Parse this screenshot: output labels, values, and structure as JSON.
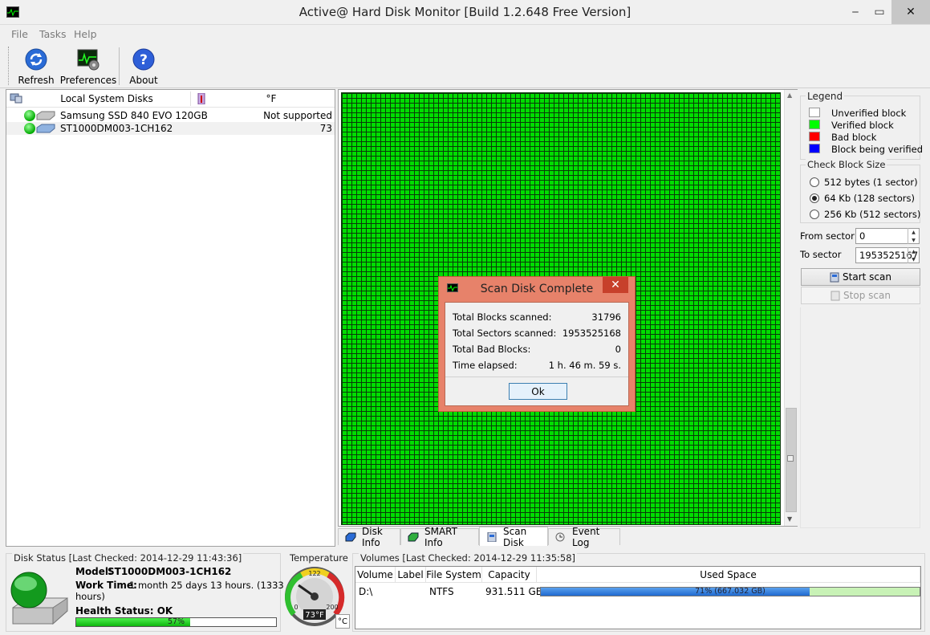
{
  "window": {
    "title": "Active@ Hard Disk Monitor [Build 1.2.648 Free Version]",
    "minimize": "‒",
    "maximize": "▭",
    "close": "✕"
  },
  "menu": {
    "file": "File",
    "tasks": "Tasks",
    "help": "Help"
  },
  "toolbar": {
    "refresh": "Refresh",
    "preferences": "Preferences",
    "about": "About"
  },
  "disks": {
    "header_name": "Local System Disks",
    "header_temp_unit": "°F",
    "items": [
      {
        "name": "Samsung SSD 840 EVO 120GB",
        "temp": "Not supported"
      },
      {
        "name": "ST1000DM003-1CH162",
        "temp": "73"
      }
    ]
  },
  "legend": {
    "title": "Legend",
    "items": [
      {
        "label": "Unverified block",
        "color": "#ffffff"
      },
      {
        "label": "Verified block",
        "color": "#00ff00"
      },
      {
        "label": "Bad block",
        "color": "#ff0000"
      },
      {
        "label": "Block being verified",
        "color": "#0000ff"
      }
    ]
  },
  "block_size": {
    "title": "Check Block Size",
    "options": [
      "512 bytes (1 sector)",
      "64 Kb (128 sectors)",
      "256 Kb (512 sectors)"
    ],
    "selected": "64 Kb (128 sectors)"
  },
  "range": {
    "from_label": "From sector",
    "from_value": "0",
    "to_label": "To sector",
    "to_value": "1953525167"
  },
  "scan_buttons": {
    "start": "Start scan",
    "stop": "Stop scan"
  },
  "tabs": {
    "disk_info": "Disk Info",
    "smart_info": "SMART Info",
    "scan_disk": "Scan Disk",
    "event_log": "Event Log",
    "active": "Scan Disk"
  },
  "dialog": {
    "title": "Scan Disk Complete",
    "rows": [
      {
        "label": "Total Blocks scanned:",
        "value": "31796"
      },
      {
        "label": "Total Sectors scanned:",
        "value": "1953525168"
      },
      {
        "label": "Total Bad Blocks:",
        "value": "0"
      },
      {
        "label": "Time elapsed:",
        "value": "1 h. 46 m. 59 s."
      }
    ],
    "ok": "Ok"
  },
  "disk_status": {
    "group_label": "Disk Status [Last Checked: 2014-12-29 11:43:36]",
    "model_label": "Model:",
    "model_value": "ST1000DM003-1CH162",
    "work_label": "Work Time:",
    "work_value": "1 month 25 days 13 hours. (1333",
    "work_value2": "hours)",
    "health": "Health Status: OK",
    "health_percent": 57,
    "health_text": "57%"
  },
  "temperature": {
    "group_label": "Temperature",
    "reading": "73°F",
    "unit_button": "°C",
    "gauge_top": "122",
    "gauge_left": "0",
    "gauge_right": "200",
    "value": 73,
    "range": [
      0,
      200
    ]
  },
  "volumes": {
    "group_label": "Volumes [Last Checked: 2014-12-29 11:35:58]",
    "headers": [
      "Volume",
      "Label",
      "File System",
      "Capacity",
      "Used Space"
    ],
    "rows": [
      {
        "volume": "D:\\",
        "label": "",
        "fs": "NTFS",
        "capacity": "931.511 GB",
        "used_text": "71% (667.032 GB)",
        "used_percent": 71
      }
    ]
  }
}
